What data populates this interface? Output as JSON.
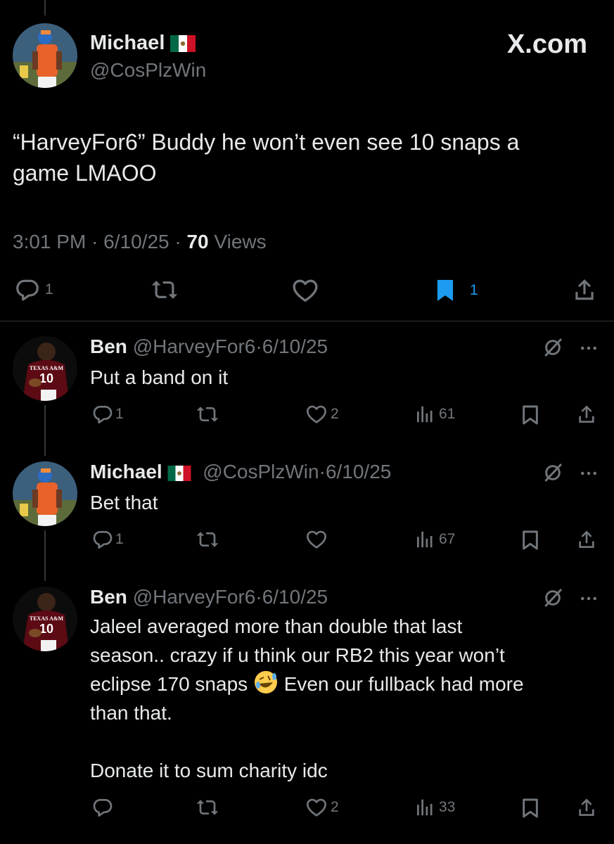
{
  "colors": {
    "background": "#000000",
    "text": "#e7e9ea",
    "muted": "#71767b",
    "accent": "#1d9bf0",
    "divider": "#2f3336"
  },
  "site_label": "X.com",
  "main_tweet": {
    "display_name": "Michael",
    "flag_emoji": "🇲🇽",
    "handle": "@CosPlzWin",
    "text_line1": "“HarveyFor6” Buddy he won’t even see 10 snaps a",
    "text_line2": "game LMAOO",
    "time": "3:01 PM",
    "date": "6/10/25",
    "views_count": "70",
    "views_label": "Views",
    "replies": "1",
    "bookmarks": "1",
    "bookmarked": true
  },
  "replies": [
    {
      "display_name": "Ben",
      "handle": "@HarveyFor6",
      "date": "6/10/25",
      "separator": "·",
      "text": "Put a band on it",
      "replies": "1",
      "likes": "2",
      "views": "61",
      "avatar_text": "TEXAS A&M"
    },
    {
      "display_name": "Michael",
      "flag_emoji": "🇲🇽",
      "handle": "@CosPlzWin",
      "date": "6/10/25",
      "separator": "·",
      "text": "Bet that",
      "replies": "1",
      "likes": "",
      "views": "67"
    },
    {
      "display_name": "Ben",
      "handle": "@HarveyFor6",
      "date": "6/10/25",
      "separator": "·",
      "text_line1": "Jaleel averaged more than double that last",
      "text_line2": "season.. crazy if u think our RB2 this year won’t",
      "text_line3a": "eclipse 170 snaps",
      "emoji": "rolling-on-floor-laughing",
      "text_line3b": "Even our fullback had more",
      "text_line4": "than that.",
      "text_line5": "Donate it to sum charity idc",
      "replies": "",
      "likes": "2",
      "views": "33",
      "avatar_text": "TEXAS A&M"
    }
  ],
  "icons": {
    "reply": "reply-icon",
    "repost": "repost-icon",
    "like": "heart-icon",
    "views": "views-chart-icon",
    "bookmark": "bookmark-icon",
    "share": "share-icon",
    "grok": "grok-icon",
    "more": "more-icon"
  }
}
